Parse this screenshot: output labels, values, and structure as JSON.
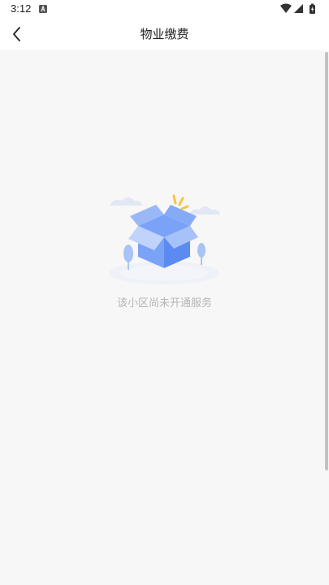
{
  "status_bar": {
    "time": "3:12",
    "icons": [
      "notification-a-icon",
      "wifi-icon",
      "signal-icon",
      "battery-charging-icon"
    ]
  },
  "app_bar": {
    "title": "物业缴费",
    "back_icon": "chevron-left-icon"
  },
  "empty_state": {
    "illustration": "open-box-icon",
    "message": "该小区尚未开通服务"
  },
  "colors": {
    "background": "#f7f7f7",
    "header": "#ffffff",
    "box_blue": "#5b8bf0",
    "accent_yellow": "#f7c445",
    "hint_text": "#b5b5b5"
  }
}
